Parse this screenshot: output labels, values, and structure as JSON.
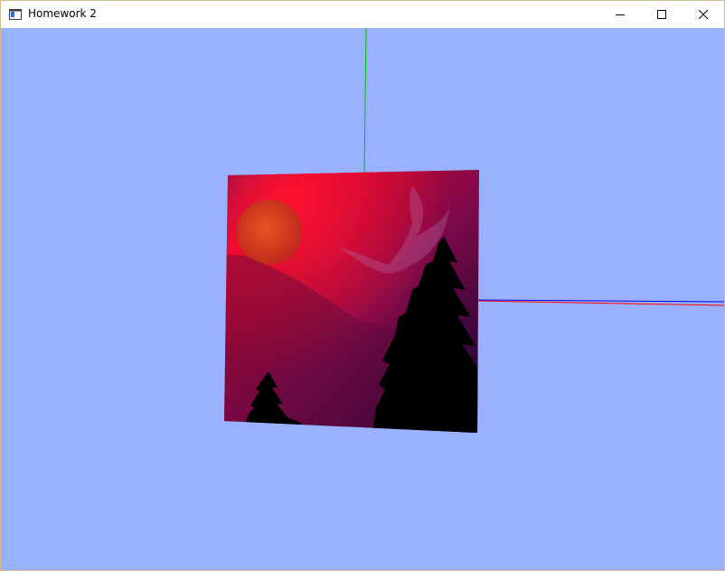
{
  "window": {
    "title": "Homework 2",
    "controls": {
      "minimize_icon": "minimize-icon",
      "maximize_icon": "maximize-icon",
      "close_icon": "close-icon"
    }
  },
  "scene": {
    "background_color": "#99b1fe",
    "axes": {
      "x_color": "#ff0000",
      "y_color": "#00c000",
      "z_color": "#0000ff"
    },
    "textured_quad": {
      "description_colors": {
        "top": "#e0002a",
        "bottom_right": "#02022e",
        "moon": "#e03a1a"
      }
    }
  }
}
